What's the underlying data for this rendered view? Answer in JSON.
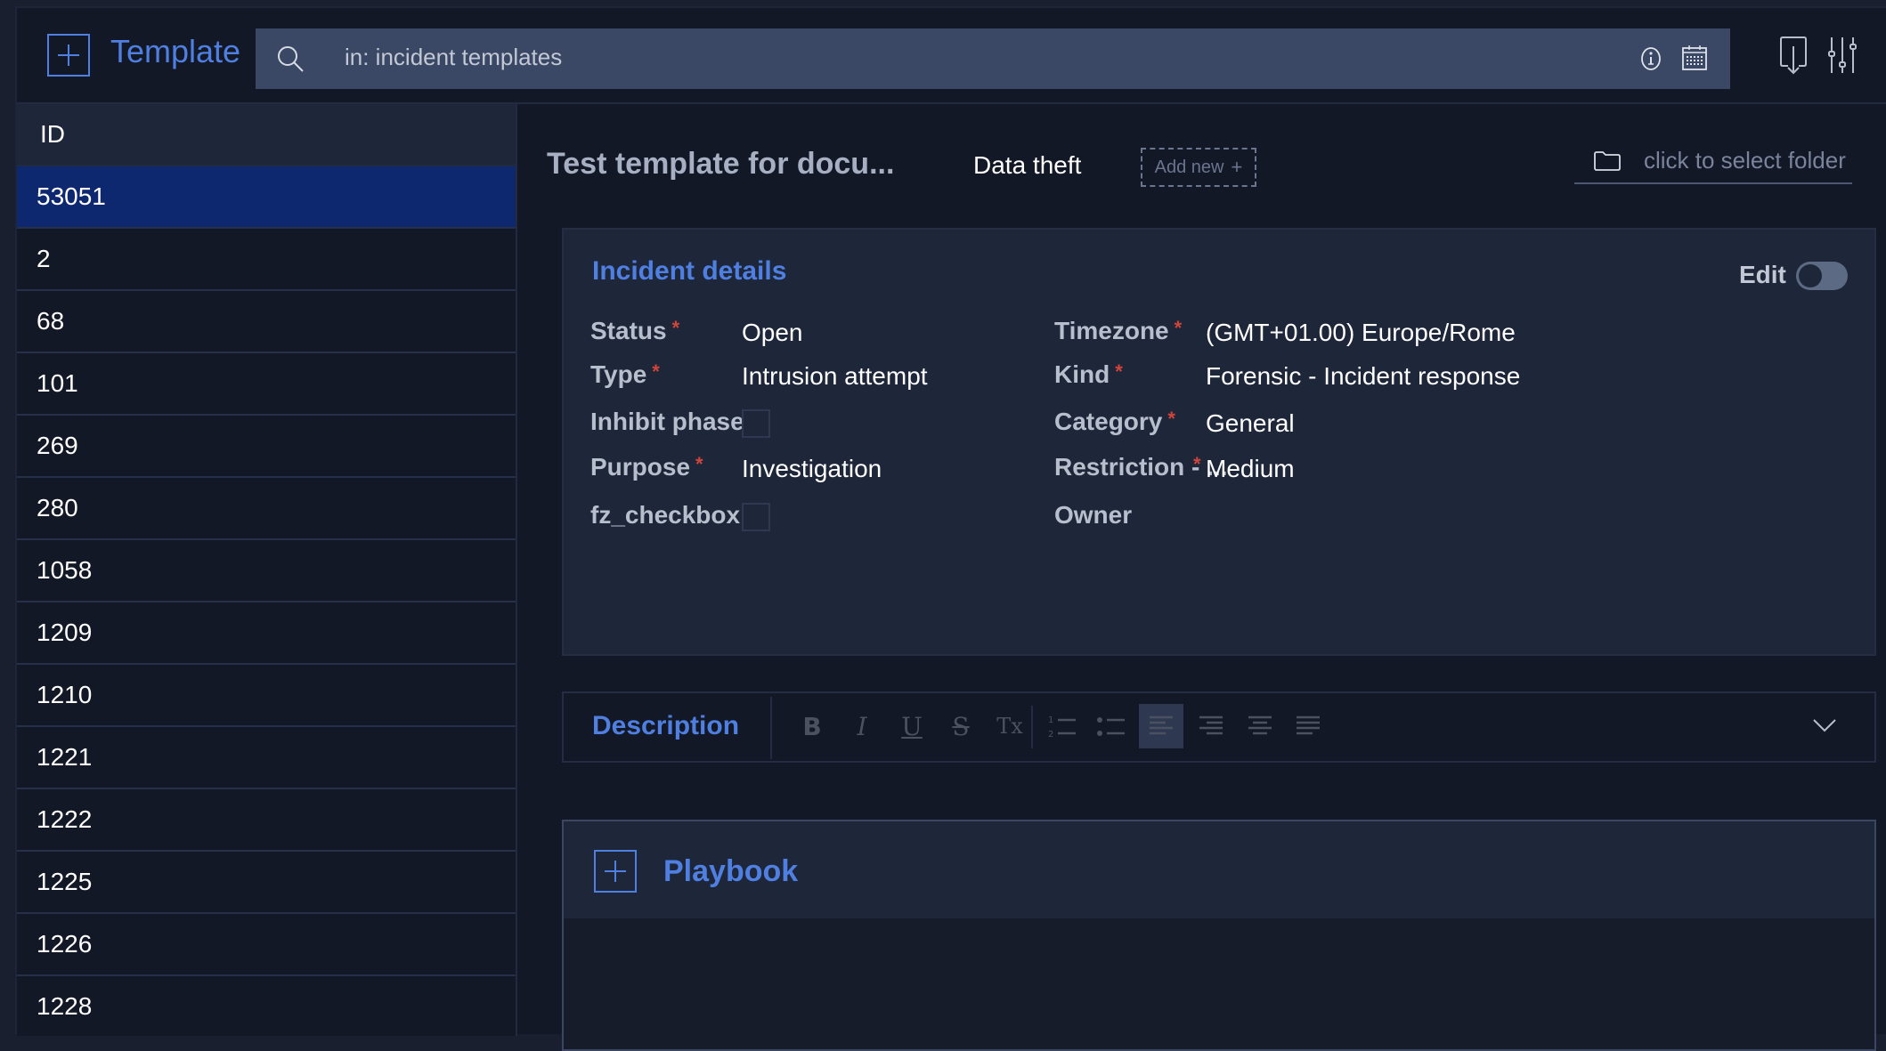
{
  "header": {
    "title": "Template",
    "search_value": "in: incident templates",
    "icons": [
      "plus-icon",
      "search-icon",
      "info-icon",
      "calendar-icon",
      "export-icon",
      "sliders-icon"
    ]
  },
  "id_list": {
    "column_header": "ID",
    "selected": "53051",
    "rows": [
      "53051",
      "2",
      "68",
      "101",
      "269",
      "280",
      "1058",
      "1209",
      "1210",
      "1221",
      "1222",
      "1225",
      "1226",
      "1228"
    ]
  },
  "template": {
    "title": "Test template for docu...",
    "tag": "Data theft",
    "add_new_label": "Add new",
    "folder_placeholder": "click to select folder"
  },
  "incident_details": {
    "title": "Incident details",
    "edit_label": "Edit",
    "edit_enabled": false,
    "left_fields": [
      {
        "label": "Status",
        "required": true,
        "value": "Open"
      },
      {
        "label": "Type",
        "required": true,
        "value": "Intrusion attempt"
      },
      {
        "label": "Inhibit phase...",
        "required": false,
        "checkbox": true,
        "checked": false
      },
      {
        "label": "Purpose",
        "required": true,
        "value": "Investigation"
      },
      {
        "label": "fz_checkbox...",
        "required": false,
        "checkbox": true,
        "checked": false
      }
    ],
    "right_fields": [
      {
        "label": "Timezone",
        "required": true,
        "value": "(GMT+01.00) Europe/Rome"
      },
      {
        "label": "Kind",
        "required": true,
        "value": "Forensic - Incident response"
      },
      {
        "label": "Category",
        "required": true,
        "value": "General"
      },
      {
        "label": "Restriction - ...",
        "required": true,
        "value": "Medium"
      },
      {
        "label": "Owner",
        "required": false,
        "value": ""
      }
    ],
    "required_marker": "*"
  },
  "description": {
    "title": "Description",
    "toolbar": [
      {
        "name": "bold",
        "glyph": "B"
      },
      {
        "name": "italic",
        "glyph": "I"
      },
      {
        "name": "underline",
        "glyph": "U"
      },
      {
        "name": "strikethrough",
        "glyph": "S"
      },
      {
        "name": "clear-format",
        "glyph": "Tx"
      },
      {
        "name": "ordered-list",
        "glyph": ""
      },
      {
        "name": "bullet-list",
        "glyph": ""
      },
      {
        "name": "align-left",
        "glyph": "",
        "active": true
      },
      {
        "name": "align-right",
        "glyph": ""
      },
      {
        "name": "align-center",
        "glyph": ""
      },
      {
        "name": "align-justify",
        "glyph": ""
      }
    ]
  },
  "playbook": {
    "title": "Playbook"
  },
  "colors": {
    "accent": "#4f7fe0",
    "selected_row": "#0e2870",
    "required": "#d0453a"
  }
}
